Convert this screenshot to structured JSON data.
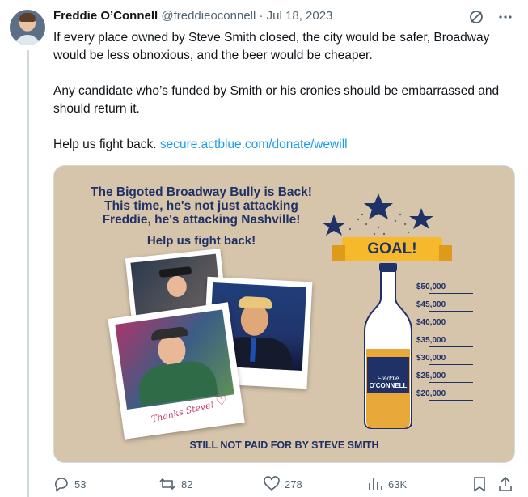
{
  "tweet": {
    "author_name": "Freddie O’Connell",
    "handle": "@freddieoconnell",
    "separator": "·",
    "date": "Jul 18, 2023",
    "paragraphs": [
      "If every place owned by Steve Smith closed, the city would be safer, Broadway would be less obnoxious, and the beer would be cheaper.",
      "Any candidate who’s funded by Smith or his cronies should be embarrassed and should return it."
    ],
    "cta_text": "Help us fight back.",
    "link": "secure.actblue.com/donate/wewill"
  },
  "header_icons": [
    "grok-icon",
    "more-icon"
  ],
  "media": {
    "headline_lines": [
      "The Bigoted Broadway Bully is Back!",
      "This time, he's not just attacking",
      "Freddie, he's attacking Nashville!"
    ],
    "subhead": "Help us fight back!",
    "goal_label": "GOAL!",
    "bottle_brand": [
      "Freddie",
      "O'CONNELL"
    ],
    "thanks_text": "Thanks Steve!",
    "levels": [
      "$50,000",
      "$45,000",
      "$40,000",
      "$35,000",
      "$30,000",
      "$25,000",
      "$20,000"
    ],
    "footer": "STILL NOT PAID FOR BY STEVE SMITH",
    "background_color": "#d6c4ab",
    "text_color": "#1f3166",
    "accent_color": "#f5b92b"
  },
  "actions": {
    "replies": "53",
    "reposts": "82",
    "likes": "278",
    "views": "63K"
  },
  "colors": {
    "link": "#1d9bf0",
    "muted": "#536471",
    "text": "#0f1419"
  }
}
